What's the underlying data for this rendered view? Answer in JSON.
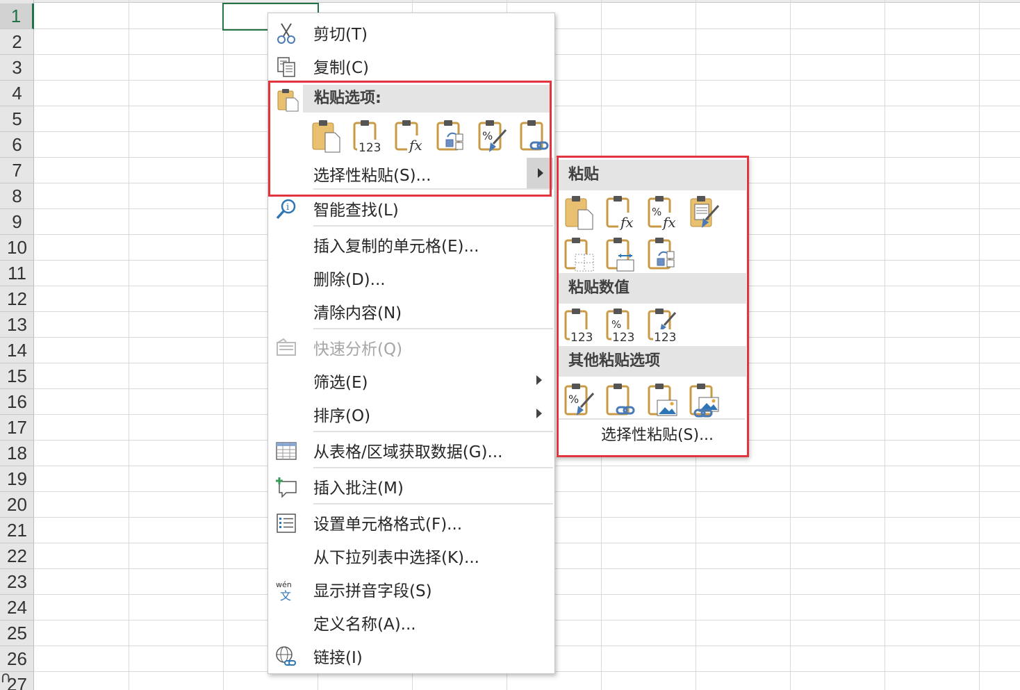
{
  "sheet": {
    "row_numbers": [
      "1",
      "2",
      "3",
      "4",
      "5",
      "6",
      "7",
      "8",
      "9",
      "10",
      "11",
      "12",
      "13",
      "14",
      "15",
      "16",
      "17",
      "18",
      "19",
      "20",
      "21",
      "22",
      "23",
      "24",
      "25",
      "26",
      "27"
    ],
    "active_row": "1",
    "accent_color": "#217346"
  },
  "context_menu": {
    "items": [
      {
        "label": "剪切(T)",
        "icon": "scissors-icon"
      },
      {
        "label": "复制(C)",
        "icon": "copy-icon"
      },
      {
        "label": "智能查找(L)",
        "icon": "smart-lookup-icon"
      },
      {
        "label": "插入复制的单元格(E)...",
        "icon": ""
      },
      {
        "label": "删除(D)...",
        "icon": ""
      },
      {
        "label": "清除内容(N)",
        "icon": ""
      },
      {
        "label": "快速分析(Q)",
        "icon": "quick-analysis-icon",
        "disabled": true
      },
      {
        "label": "筛选(E)",
        "icon": "",
        "submenu": true
      },
      {
        "label": "排序(O)",
        "icon": "",
        "submenu": true
      },
      {
        "label": "从表格/区域获取数据(G)...",
        "icon": "table-icon"
      },
      {
        "label": "插入批注(M)",
        "icon": "new-comment-icon"
      },
      {
        "label": "设置单元格格式(F)...",
        "icon": "format-cells-icon"
      },
      {
        "label": "从下拉列表中选择(K)...",
        "icon": ""
      },
      {
        "label": "显示拼音字段(S)",
        "icon": "phonetic-icon"
      },
      {
        "label": "定义名称(A)...",
        "icon": ""
      },
      {
        "label": "链接(I)",
        "icon": "link-icon"
      }
    ],
    "paste_options_heading": "粘贴选项:",
    "paste_buttons": [
      "paste-icon",
      "paste-values-icon",
      "paste-formulas-icon",
      "paste-transpose-icon",
      "paste-formatting-icon",
      "paste-link-icon"
    ],
    "paste_values_badge": "123",
    "paste_special_label": "选择性粘贴(S)...",
    "highlight_color": "#e2343f"
  },
  "paste_submenu": {
    "paste_heading": "粘贴",
    "paste_row1": [
      "paste-icon",
      "paste-formulas-icon",
      "paste-formulas-number-format-icon",
      "keep-source-formatting-icon"
    ],
    "paste_row2": [
      "no-borders-icon",
      "keep-column-widths-icon",
      "transpose-icon"
    ],
    "values_heading": "粘贴数值",
    "values_row": [
      "values-icon",
      "values-number-format-icon",
      "values-source-formatting-icon"
    ],
    "values_badge": "123",
    "other_heading": "其他粘贴选项",
    "other_row": [
      "formatting-icon",
      "paste-link-icon",
      "picture-icon",
      "linked-picture-icon"
    ],
    "special_label": "选择性粘贴(S)..."
  }
}
